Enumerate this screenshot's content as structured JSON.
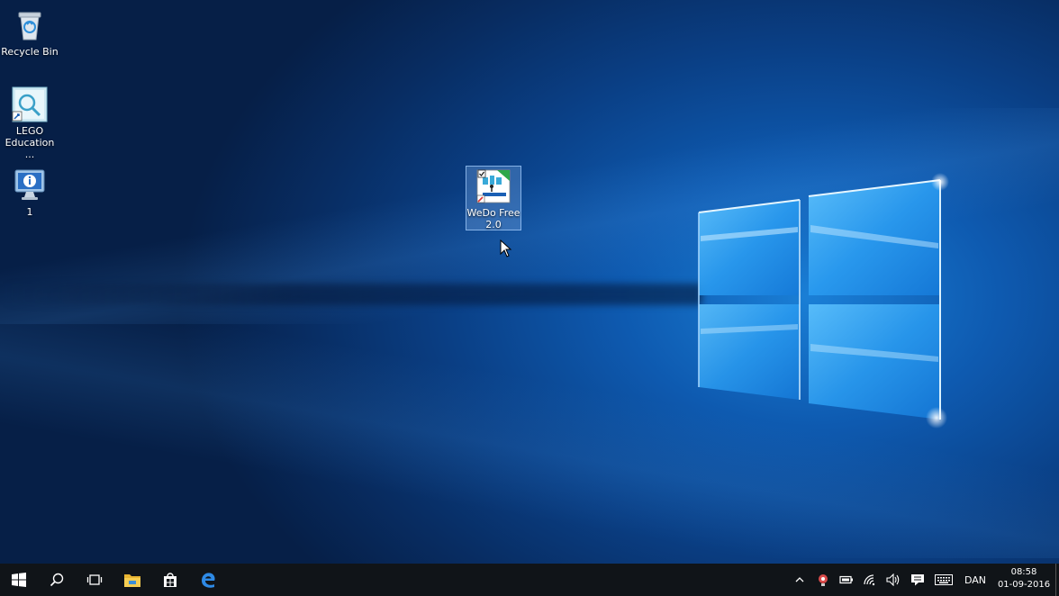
{
  "desktop": {
    "icons": [
      {
        "label": "Recycle Bin",
        "icon": "recycle-bin-icon"
      },
      {
        "label": "LEGO\nEducation ...",
        "icon": "lego-education-icon"
      },
      {
        "label": "1",
        "icon": "info-monitor-icon"
      },
      {
        "label": "WeDo Free\n2.0",
        "icon": "wedo-app-icon"
      }
    ]
  },
  "taskbar": {
    "buttons": [
      {
        "icon": "windows-start-icon"
      },
      {
        "icon": "search-icon"
      },
      {
        "icon": "task-view-icon"
      },
      {
        "icon": "file-explorer-icon"
      },
      {
        "icon": "store-icon"
      },
      {
        "icon": "edge-icon"
      }
    ],
    "tray": {
      "language": "DAN",
      "time": "08:58",
      "date": "01-09-2016"
    }
  },
  "colors": {
    "accent": "#1a7fd6",
    "taskbar": "#101418"
  }
}
